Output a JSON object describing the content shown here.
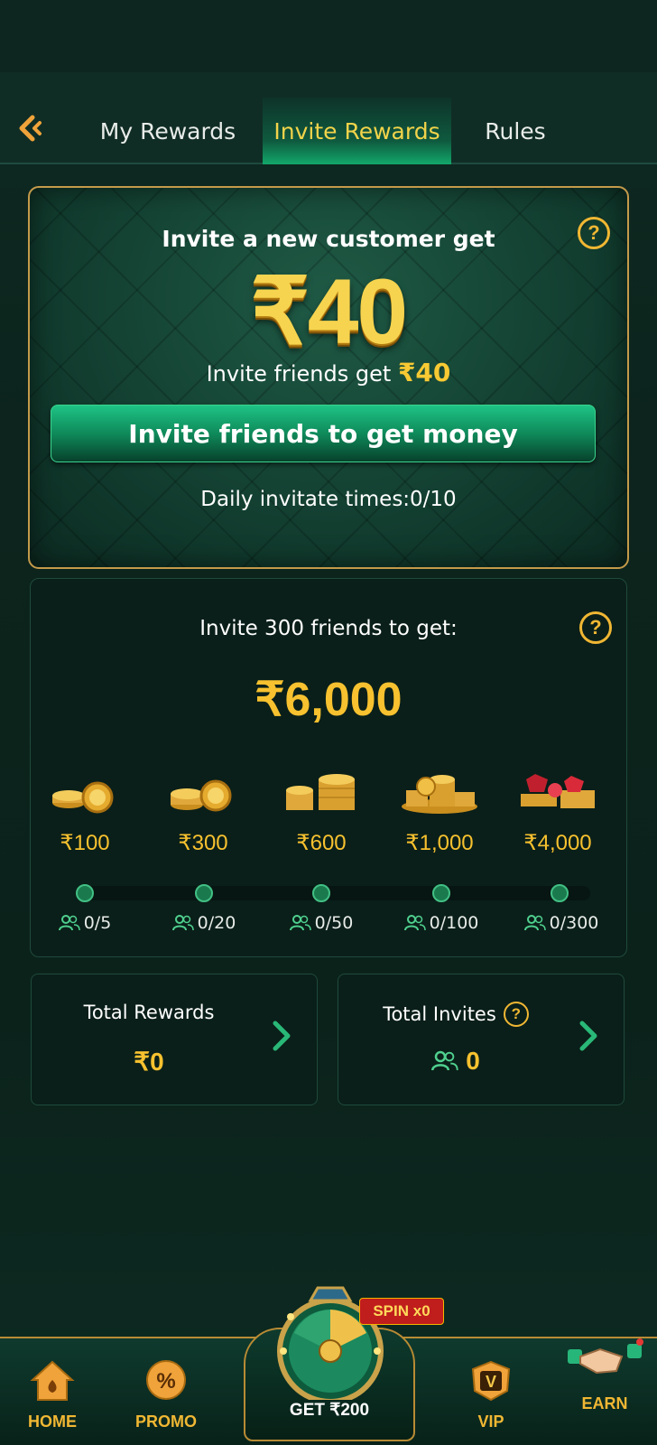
{
  "header": {
    "tabs": [
      {
        "label": "My Rewards",
        "active": false
      },
      {
        "label": "Invite Rewards",
        "active": true
      },
      {
        "label": "Rules",
        "active": false
      }
    ]
  },
  "hero": {
    "title": "Invite a new customer get",
    "amount": "₹40",
    "subtitle_text": "Invite friends get",
    "subtitle_amount": "₹40",
    "button_label": "Invite friends to get money",
    "daily_times": "Daily invitate times:0/10",
    "help_glyph": "?"
  },
  "milestone": {
    "title": "Invite 300 friends to get:",
    "amount": "₹6,000",
    "help_glyph": "?",
    "tiers": [
      {
        "reward": "₹100",
        "progress": "0/5"
      },
      {
        "reward": "₹300",
        "progress": "0/20"
      },
      {
        "reward": "₹600",
        "progress": "0/50"
      },
      {
        "reward": "₹1,000",
        "progress": "0/100"
      },
      {
        "reward": "₹4,000",
        "progress": "0/300"
      }
    ]
  },
  "stats": {
    "total_rewards_label": "Total Rewards",
    "total_rewards_value": "₹0",
    "total_invites_label": "Total Invites",
    "total_invites_value": "0",
    "help_glyph": "?"
  },
  "nav": {
    "home": "HOME",
    "promo": "PROMO",
    "center": "GET ₹200",
    "spin_badge": "SPIN x0",
    "vip": "VIP",
    "earn": "EARN",
    "promo_glyph": "%",
    "vip_glyph": "V"
  },
  "colors": {
    "gold": "#f7c12f",
    "accent_green": "#12a86a",
    "background": "#0c241d"
  }
}
